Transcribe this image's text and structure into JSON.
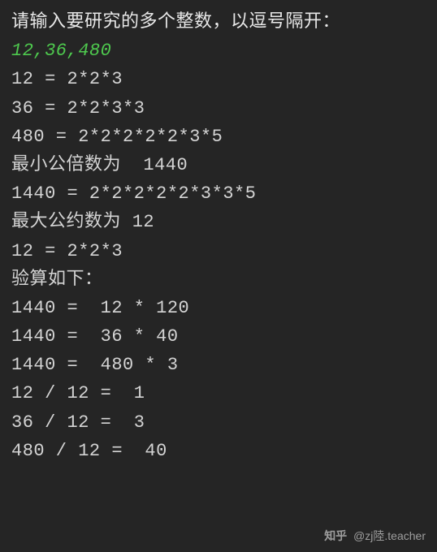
{
  "terminal": {
    "prompt": "请输入要研究的多个整数，以逗号隔开：",
    "userInput": "12,36,480",
    "lines": [
      "12 = 2*2*3",
      "36 = 2*2*3*3",
      "480 = 2*2*2*2*2*3*5",
      "最小公倍数为  1440",
      "1440 = 2*2*2*2*2*3*3*5",
      "最大公约数为 12",
      "12 = 2*2*3",
      "验算如下：",
      "1440 =  12 * 120",
      "1440 =  36 * 40",
      "1440 =  480 * 3",
      "12 / 12 =  1",
      "36 / 12 =  3",
      "480 / 12 =  40"
    ]
  },
  "watermark": {
    "brand": "知乎",
    "handle": "@zj陸.teacher"
  },
  "colors": {
    "background": "#252525",
    "text": "#d4d4d4",
    "input": "#4ec94e"
  }
}
